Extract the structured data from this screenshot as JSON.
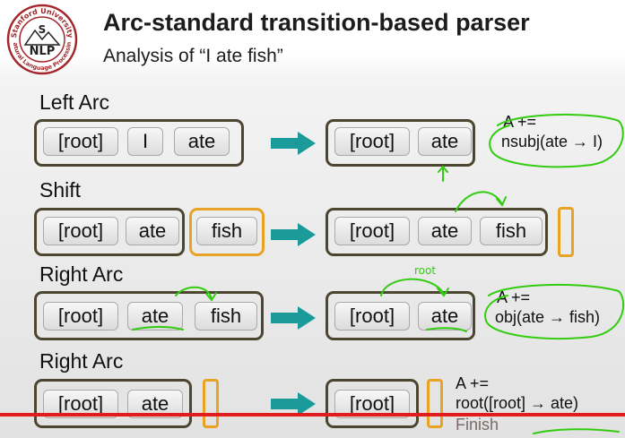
{
  "logo": {
    "ring_top": "Stanford University",
    "ring_bottom": "Natural Language Processing",
    "s": "S",
    "nlp": "NLP"
  },
  "title": "Arc-standard transition-based parser",
  "subtitle": "Analysis of “I ate fish”",
  "rows": [
    {
      "label": "Left Arc",
      "left_tokens": [
        "[root]",
        "I",
        "ate"
      ],
      "right_tokens": [
        "[root]",
        "ate"
      ],
      "note_line1": "A +=",
      "note_line2": "nsubj(ate → I)"
    },
    {
      "label": "Shift",
      "left_tokens": [
        "[root]",
        "ate"
      ],
      "left_buffer": [
        "fish"
      ],
      "right_tokens": [
        "[root]",
        "ate",
        "fish"
      ]
    },
    {
      "label": "Right Arc",
      "left_tokens": [
        "[root]",
        "ate",
        "fish"
      ],
      "right_tokens": [
        "[root]",
        "ate"
      ],
      "note_line1": "A +=",
      "note_line2": "obj(ate → fish)"
    },
    {
      "label": "Right Arc",
      "left_tokens": [
        "[root]",
        "ate"
      ],
      "right_tokens": [
        "[root]"
      ],
      "note_line1": "A +=",
      "note_line2": "root([root] → ate)",
      "note_line3": "Finish"
    }
  ],
  "handwriting": {
    "root_label": "root"
  },
  "colors": {
    "stack_border": "#4c4630",
    "buffer_border": "#e8a224",
    "arrow": "#1a9a98",
    "ink": "#33cc11",
    "progress": "#e21b1b"
  }
}
